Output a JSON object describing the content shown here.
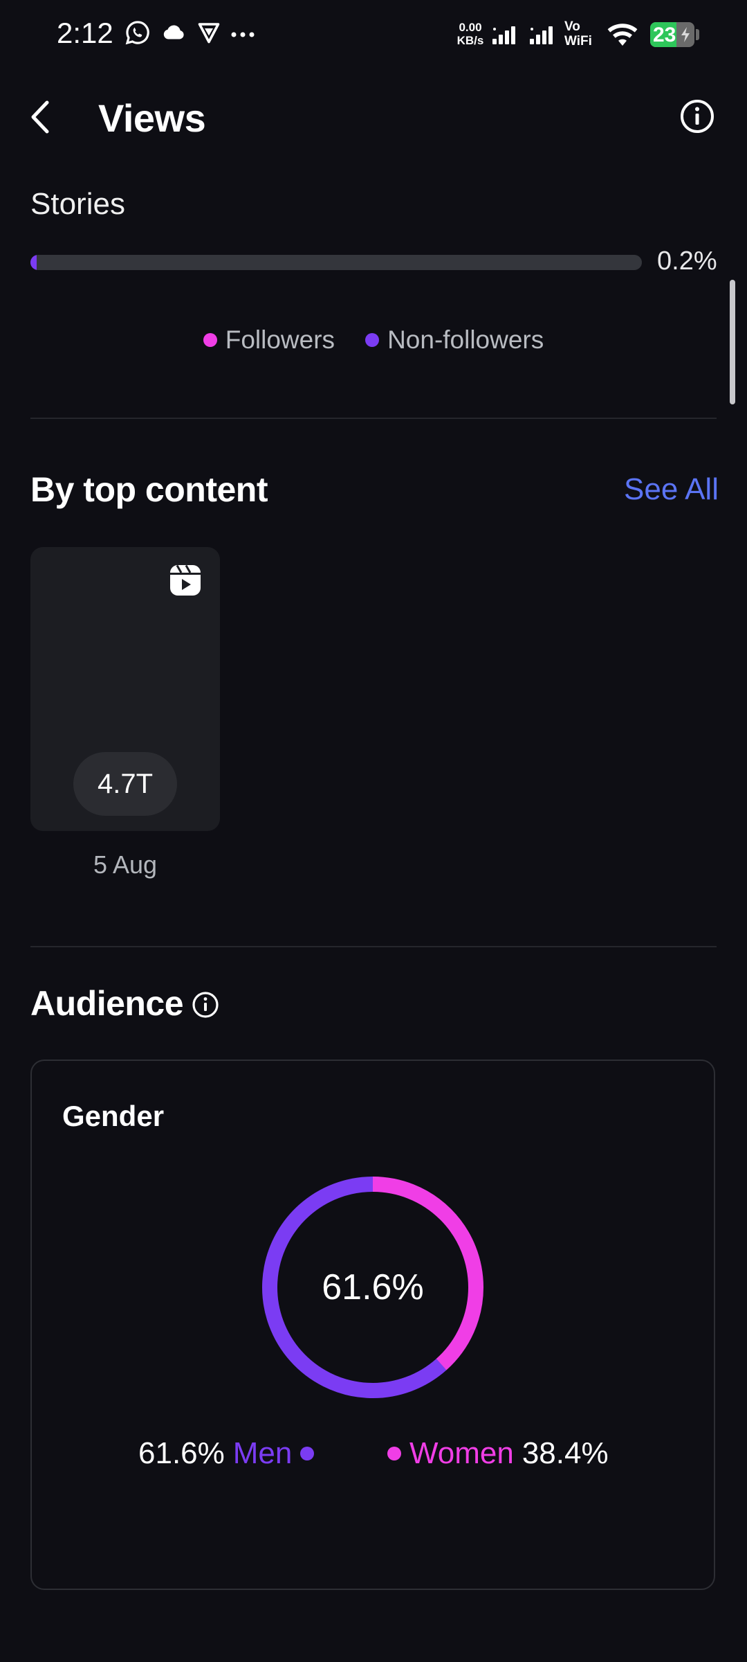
{
  "status_bar": {
    "time": "2:12",
    "net_speed_value": "0.00",
    "net_speed_unit": "KB/s",
    "vowifi_top": "Vo",
    "vowifi_bottom": "WiFi",
    "battery": "23",
    "icons": [
      "whatsapp-icon",
      "cloud-icon",
      "vpn-shield-icon",
      "more-dots-icon",
      "signal-icon",
      "signal-icon",
      "wifi-icon",
      "battery-charging-icon"
    ]
  },
  "header": {
    "title": "Views",
    "back_icon": "chevron-left-icon",
    "info_icon": "info-icon"
  },
  "stories": {
    "label": "Stories",
    "percent_text": "0.2%",
    "fill_fraction": 0.002,
    "legend": [
      {
        "label": "Followers",
        "color": "#f03ee6"
      },
      {
        "label": "Non-followers",
        "color": "#7b3cf3"
      }
    ]
  },
  "top_content": {
    "title": "By top content",
    "see_all": "See All",
    "items": [
      {
        "views": "4.7T",
        "date": "5 Aug",
        "icon": "reels-icon"
      }
    ]
  },
  "audience": {
    "title": "Audience",
    "gender": {
      "title": "Gender",
      "center_text": "61.6%",
      "men": {
        "label": "Men",
        "value": "61.6%",
        "fraction": 0.616,
        "color": "#7b3cf3"
      },
      "women": {
        "label": "Women",
        "value": "38.4%",
        "fraction": 0.384,
        "color": "#f03ee6"
      }
    }
  },
  "colors": {
    "background": "#0e0e14",
    "accent_link": "#5b74f5",
    "men": "#7b3cf3",
    "women": "#f03ee6"
  }
}
